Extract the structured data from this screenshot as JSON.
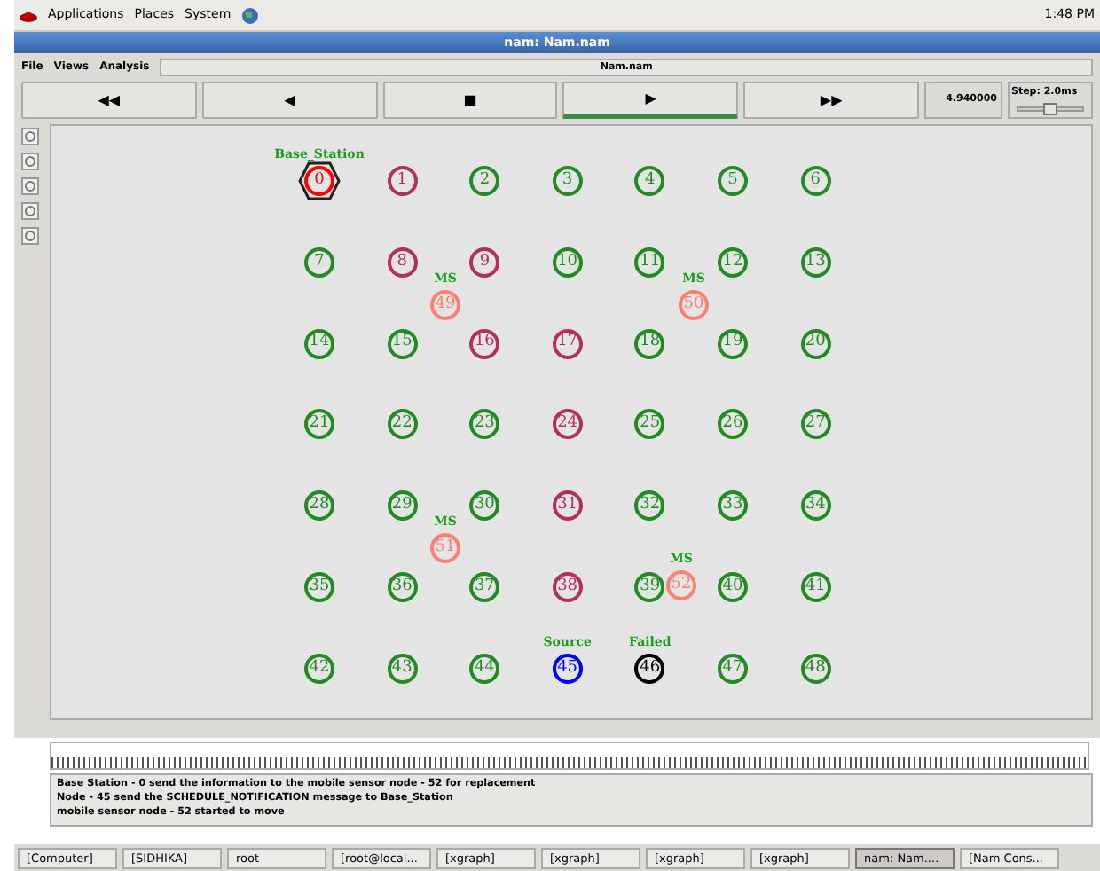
{
  "top_panel": {
    "menus": [
      "Applications",
      "Places",
      "System"
    ],
    "clock": "1:48 PM"
  },
  "window": {
    "title": "nam: Nam.nam"
  },
  "menu": [
    "File",
    "Views",
    "Analysis"
  ],
  "file_label": "Nam.nam",
  "controls": [
    {
      "glyph": "◀◀",
      "selected": false
    },
    {
      "glyph": "◀",
      "selected": false
    },
    {
      "glyph": "■",
      "selected": false
    },
    {
      "glyph": "▶",
      "selected": true
    },
    {
      "glyph": "▶▶",
      "selected": false
    }
  ],
  "time": "4.940000",
  "step": "Step: 2.0ms",
  "step_slider": {
    "level": 0.5
  },
  "nodes": [
    {
      "label": "0",
      "color": "#ff0000",
      "kind": "hexagon",
      "tag": "Base_Station"
    },
    {
      "label": "1",
      "color": "#b03060"
    },
    {
      "label": "2",
      "color": "#228b22"
    },
    {
      "label": "3",
      "color": "#228b22"
    },
    {
      "label": "4",
      "color": "#228b22"
    },
    {
      "label": "5",
      "color": "#228b22"
    },
    {
      "label": "6",
      "color": "#228b22"
    },
    {
      "label": "7",
      "color": "#228b22"
    },
    {
      "label": "8",
      "color": "#b03060"
    },
    {
      "label": "9",
      "color": "#b03060"
    },
    {
      "label": "10",
      "color": "#228b22"
    },
    {
      "label": "11",
      "color": "#228b22"
    },
    {
      "label": "12",
      "color": "#228b22"
    },
    {
      "label": "13",
      "color": "#228b22"
    },
    {
      "label": "14",
      "color": "#228b22"
    },
    {
      "label": "15",
      "color": "#228b22"
    },
    {
      "label": "16",
      "color": "#b03060"
    },
    {
      "label": "17",
      "color": "#b03060"
    },
    {
      "label": "18",
      "color": "#228b22"
    },
    {
      "label": "19",
      "color": "#228b22"
    },
    {
      "label": "20",
      "color": "#228b22"
    },
    {
      "label": "21",
      "color": "#228b22"
    },
    {
      "label": "22",
      "color": "#228b22"
    },
    {
      "label": "23",
      "color": "#228b22"
    },
    {
      "label": "24",
      "color": "#b03060"
    },
    {
      "label": "25",
      "color": "#228b22"
    },
    {
      "label": "26",
      "color": "#228b22"
    },
    {
      "label": "27",
      "color": "#228b22"
    },
    {
      "label": "28",
      "color": "#228b22"
    },
    {
      "label": "29",
      "color": "#228b22"
    },
    {
      "label": "30",
      "color": "#228b22"
    },
    {
      "label": "31",
      "color": "#b03060"
    },
    {
      "label": "32",
      "color": "#228b22"
    },
    {
      "label": "33",
      "color": "#228b22"
    },
    {
      "label": "34",
      "color": "#228b22"
    },
    {
      "label": "35",
      "color": "#228b22"
    },
    {
      "label": "36",
      "color": "#228b22"
    },
    {
      "label": "37",
      "color": "#228b22"
    },
    {
      "label": "38",
      "color": "#b03060"
    },
    {
      "label": "39",
      "color": "#228b22"
    },
    {
      "label": "40",
      "color": "#228b22"
    },
    {
      "label": "41",
      "color": "#228b22"
    },
    {
      "label": "42",
      "color": "#228b22"
    },
    {
      "label": "43",
      "color": "#228b22"
    },
    {
      "label": "44",
      "color": "#228b22"
    },
    {
      "label": "45",
      "color": "#0000ff",
      "tag": "Source"
    },
    {
      "label": "46",
      "color": "#000000",
      "tag": "Failed"
    },
    {
      "label": "47",
      "color": "#228b22"
    },
    {
      "label": "48",
      "color": "#228b22"
    },
    {
      "label": "49",
      "color": "#fa8072",
      "tag": "MS"
    },
    {
      "label": "50",
      "color": "#fa8072",
      "tag": "MS"
    },
    {
      "label": "51",
      "color": "#fa8072",
      "tag": "MS"
    },
    {
      "label": "52",
      "color": "#fa8072",
      "tag": "MS"
    }
  ],
  "log": [
    "Base Station - 0 send the information to the mobile sensor node - 52 for replacement",
    "Node - 45 send the SCHEDULE_NOTIFICATION message to Base_Station",
    "mobile sensor node - 52 started to move"
  ],
  "taskbar": [
    {
      "label": "[Computer]",
      "selected": false
    },
    {
      "label": "[SIDHIKA]",
      "selected": false
    },
    {
      "label": "root",
      "selected": false
    },
    {
      "label": "[root@local...",
      "selected": false
    },
    {
      "label": "[xgraph]",
      "selected": false
    },
    {
      "label": "[xgraph]",
      "selected": false
    },
    {
      "label": "[xgraph]",
      "selected": false
    },
    {
      "label": "[xgraph]",
      "selected": false
    },
    {
      "label": "nam: Nam....",
      "selected": true
    },
    {
      "label": "[Nam Cons...",
      "selected": false
    }
  ]
}
